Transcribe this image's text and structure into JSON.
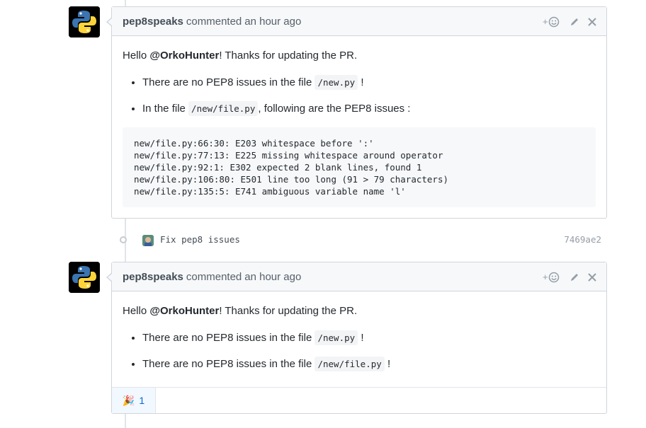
{
  "comments": [
    {
      "author": "pep8speaks",
      "verb": "commented",
      "timestamp": "an hour ago",
      "greeting_prefix": "Hello ",
      "mention": "@OrkoHunter",
      "greeting_suffix": "! Thanks for updating the PR.",
      "items": [
        {
          "pre": "There are no PEP8 issues in the file ",
          "code": "/new.py",
          "post": " !"
        },
        {
          "pre": "In the file ",
          "code": "/new/file.py",
          "post": ", following are the PEP8 issues :"
        }
      ],
      "code_block": [
        "new/file.py:66:30: E203 whitespace before ':'",
        "new/file.py:77:13: E225 missing whitespace around operator",
        "new/file.py:92:1: E302 expected 2 blank lines, found 1",
        "new/file.py:106:80: E501 line too long (91 > 79 characters)",
        "new/file.py:135:5: E741 ambiguous variable name 'l'"
      ]
    },
    {
      "author": "pep8speaks",
      "verb": "commented",
      "timestamp": "an hour ago",
      "greeting_prefix": "Hello ",
      "mention": "@OrkoHunter",
      "greeting_suffix": "! Thanks for updating the PR.",
      "items": [
        {
          "pre": "There are no PEP8 issues in the file ",
          "code": "/new.py",
          "post": " !"
        },
        {
          "pre": "There are no PEP8 issues in the file ",
          "code": "/new/file.py",
          "post": " !"
        }
      ],
      "reaction": {
        "emoji": "🎉",
        "count": "1"
      }
    }
  ],
  "commit": {
    "message": "Fix pep8 issues",
    "sha": "7469ae2"
  },
  "icons": {
    "add_reaction": "smiley-plus-icon",
    "edit": "pencil-icon",
    "delete": "close-icon"
  },
  "colors": {
    "accent": "#0366d6",
    "header_bg": "#f6f8fa",
    "border": "#d1d5da"
  }
}
